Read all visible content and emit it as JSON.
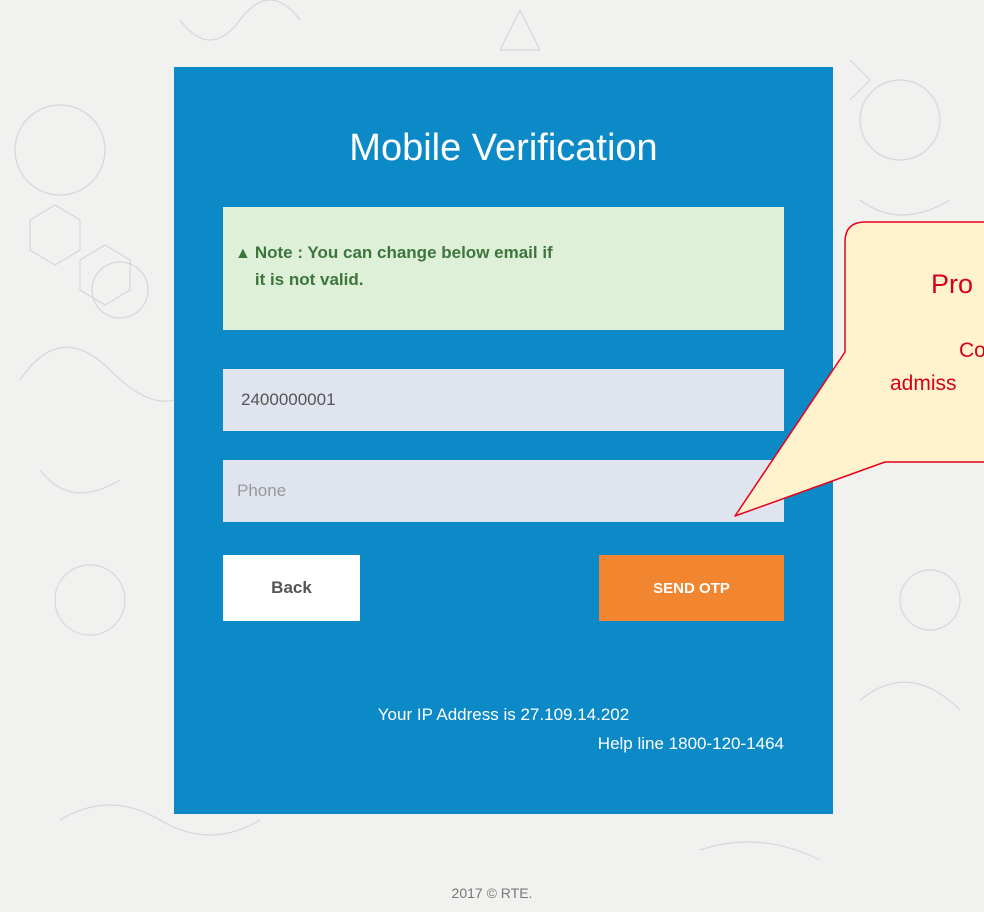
{
  "card": {
    "title": "Mobile Verification",
    "note_icon": "warning-triangle-icon",
    "note_text": "Note : You can change below email if it is not valid.",
    "userid_value": "2400000001",
    "phone_placeholder": "Phone",
    "back_label": "Back",
    "send_label": "SEND OTP",
    "ip_text": "Your IP Address is 27.109.14.202",
    "helpline_text": "Help line 1800-120-1464"
  },
  "footer": {
    "text": "2017 © RTE."
  },
  "callout": {
    "line1": "Pro",
    "line2": "Co",
    "line3": "admiss"
  },
  "colors": {
    "card": "#0c8ac8",
    "note_bg": "#dff0d8",
    "note_text": "#3c763d",
    "send_button": "#f2852f",
    "callout_bg": "#fff2cc",
    "callout_border": "#e8001c"
  }
}
